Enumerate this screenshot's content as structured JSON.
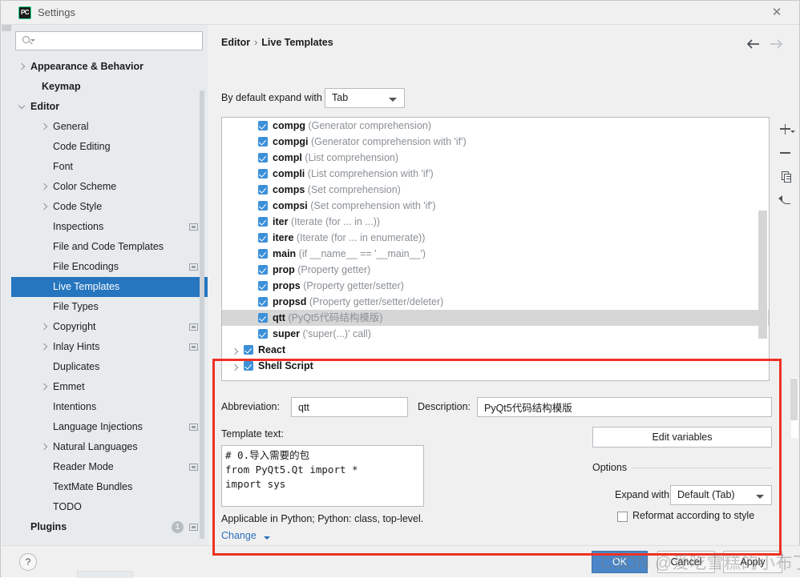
{
  "window": {
    "title": "Settings",
    "app_icon": "pycharm-icon",
    "close_label": "✕"
  },
  "search": {
    "placeholder": "",
    "value": "",
    "icon": "search-icon"
  },
  "sidebar": {
    "items": [
      {
        "label": "Appearance & Behavior",
        "indent": 24,
        "bold": true,
        "chev": "right",
        "modified": false,
        "selected": false
      },
      {
        "label": "Keymap",
        "indent": 38,
        "bold": true,
        "chev": "none",
        "modified": false,
        "selected": false
      },
      {
        "label": "Editor",
        "indent": 24,
        "bold": true,
        "chev": "down",
        "modified": false,
        "selected": false
      },
      {
        "label": "General",
        "indent": 52,
        "bold": false,
        "chev": "right",
        "modified": false,
        "selected": false
      },
      {
        "label": "Code Editing",
        "indent": 52,
        "bold": false,
        "chev": "none",
        "modified": false,
        "selected": false
      },
      {
        "label": "Font",
        "indent": 52,
        "bold": false,
        "chev": "none",
        "modified": false,
        "selected": false
      },
      {
        "label": "Color Scheme",
        "indent": 52,
        "bold": false,
        "chev": "right",
        "modified": false,
        "selected": false
      },
      {
        "label": "Code Style",
        "indent": 52,
        "bold": false,
        "chev": "right",
        "modified": false,
        "selected": false
      },
      {
        "label": "Inspections",
        "indent": 52,
        "bold": false,
        "chev": "none",
        "modified": true,
        "selected": false
      },
      {
        "label": "File and Code Templates",
        "indent": 52,
        "bold": false,
        "chev": "none",
        "modified": false,
        "selected": false
      },
      {
        "label": "File Encodings",
        "indent": 52,
        "bold": false,
        "chev": "none",
        "modified": true,
        "selected": false
      },
      {
        "label": "Live Templates",
        "indent": 52,
        "bold": false,
        "chev": "none",
        "modified": false,
        "selected": true
      },
      {
        "label": "File Types",
        "indent": 52,
        "bold": false,
        "chev": "none",
        "modified": false,
        "selected": false
      },
      {
        "label": "Copyright",
        "indent": 52,
        "bold": false,
        "chev": "right",
        "modified": true,
        "selected": false
      },
      {
        "label": "Inlay Hints",
        "indent": 52,
        "bold": false,
        "chev": "right",
        "modified": true,
        "selected": false
      },
      {
        "label": "Duplicates",
        "indent": 52,
        "bold": false,
        "chev": "none",
        "modified": false,
        "selected": false
      },
      {
        "label": "Emmet",
        "indent": 52,
        "bold": false,
        "chev": "right",
        "modified": false,
        "selected": false
      },
      {
        "label": "Intentions",
        "indent": 52,
        "bold": false,
        "chev": "none",
        "modified": false,
        "selected": false
      },
      {
        "label": "Language Injections",
        "indent": 52,
        "bold": false,
        "chev": "none",
        "modified": true,
        "selected": false
      },
      {
        "label": "Natural Languages",
        "indent": 52,
        "bold": false,
        "chev": "right",
        "modified": false,
        "selected": false
      },
      {
        "label": "Reader Mode",
        "indent": 52,
        "bold": false,
        "chev": "none",
        "modified": true,
        "selected": false
      },
      {
        "label": "TextMate Bundles",
        "indent": 52,
        "bold": false,
        "chev": "none",
        "modified": false,
        "selected": false
      },
      {
        "label": "TODO",
        "indent": 52,
        "bold": false,
        "chev": "none",
        "modified": false,
        "selected": false
      },
      {
        "label": "Plugins",
        "indent": 24,
        "bold": true,
        "chev": "none",
        "modified": true,
        "selected": false,
        "badge": "1"
      }
    ]
  },
  "content": {
    "breadcrumb": {
      "root": "Editor",
      "separator": "›",
      "leaf": "Live Templates"
    },
    "nav": {
      "back": "back-arrow",
      "forward": "forward-arrow"
    },
    "expand_row": {
      "label": "By default expand with",
      "value": "Tab"
    }
  },
  "templates": {
    "rows": [
      {
        "type": "template",
        "abbr": "compg",
        "desc": "(Generator comprehension)",
        "checked": true,
        "selected": false
      },
      {
        "type": "template",
        "abbr": "compgi",
        "desc": "(Generator comprehension with 'if')",
        "checked": true,
        "selected": false
      },
      {
        "type": "template",
        "abbr": "compl",
        "desc": "(List comprehension)",
        "checked": true,
        "selected": false
      },
      {
        "type": "template",
        "abbr": "compli",
        "desc": "(List comprehension with 'if')",
        "checked": true,
        "selected": false
      },
      {
        "type": "template",
        "abbr": "comps",
        "desc": "(Set comprehension)",
        "checked": true,
        "selected": false
      },
      {
        "type": "template",
        "abbr": "compsi",
        "desc": "(Set comprehension with 'if')",
        "checked": true,
        "selected": false
      },
      {
        "type": "template",
        "abbr": "iter",
        "desc": "(Iterate (for ... in ...))",
        "checked": true,
        "selected": false
      },
      {
        "type": "template",
        "abbr": "itere",
        "desc": "(Iterate (for ... in enumerate))",
        "checked": true,
        "selected": false
      },
      {
        "type": "template",
        "abbr": "main",
        "desc": "(if __name__ == '__main__')",
        "checked": true,
        "selected": false
      },
      {
        "type": "template",
        "abbr": "prop",
        "desc": "(Property getter)",
        "checked": true,
        "selected": false
      },
      {
        "type": "template",
        "abbr": "props",
        "desc": "(Property getter/setter)",
        "checked": true,
        "selected": false
      },
      {
        "type": "template",
        "abbr": "propsd",
        "desc": "(Property getter/setter/deleter)",
        "checked": true,
        "selected": false
      },
      {
        "type": "template",
        "abbr": "qtt",
        "desc": "(PyQt5代码结构模版)",
        "checked": true,
        "selected": true
      },
      {
        "type": "template",
        "abbr": "super",
        "desc": "('super(...)' call)",
        "checked": true,
        "selected": false
      },
      {
        "type": "group",
        "abbr": "React",
        "desc": "",
        "checked": true,
        "selected": false
      },
      {
        "type": "group",
        "abbr": "Shell Script",
        "desc": "",
        "checked": true,
        "selected": false
      }
    ]
  },
  "toolbar": {
    "add": "add-icon",
    "remove": "remove-icon",
    "duplicate": "duplicate-icon",
    "revert": "revert-icon"
  },
  "editor": {
    "abbreviation_label": "Abbreviation:",
    "abbreviation_value": "qtt",
    "description_label": "Description:",
    "description_value": "PyQt5代码结构模版",
    "template_text_label": "Template text:",
    "template_text_value": "# 0.导入需要的包\nfrom PyQt5.Qt import *\nimport sys",
    "applicable_text": "Applicable in Python; Python: class, top-level.",
    "change_link": "Change",
    "edit_variables_label": "Edit variables",
    "options_title": "Options",
    "expand_with_label": "Expand with",
    "expand_with_value": "Default (Tab)",
    "reformat_label": "Reformat according to style",
    "reformat_checked": false
  },
  "footer": {
    "help": "?",
    "ok": "OK",
    "cancel": "Cancel",
    "apply": "Apply"
  },
  "watermark": {
    "text": "CSDN @爱吃雪糕的小布丁"
  },
  "colors": {
    "accent_blue": "#2675bf",
    "checkbox_blue": "#3c90d9",
    "ok_button": "#4a86c8",
    "annotation_red": "#ef3124",
    "sidebar_bg": "#e7ebee",
    "panel_bg": "#f0f0f0",
    "link_blue": "#2d6fba"
  }
}
